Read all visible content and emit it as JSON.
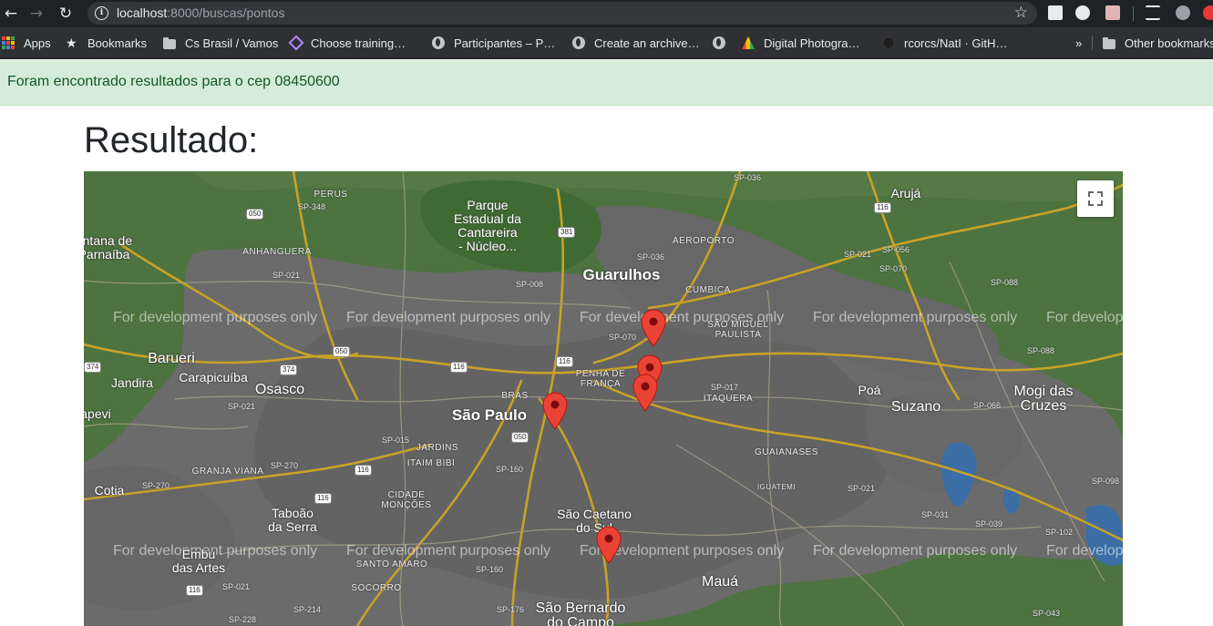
{
  "browser": {
    "url_host": "localhost",
    "url_path": ":8000/buscas/pontos",
    "back_icon": "arrow-left-icon",
    "forward_icon": "arrow-right-icon",
    "reload_icon": "reload-icon",
    "bookmarks": {
      "apps": "Apps",
      "bookmarks": "Bookmarks",
      "cs_brasil": "Cs Brasil / Vamos",
      "choose_training": "Choose training…",
      "participantes": "Participantes – P…",
      "create_archive": "Create an archive…",
      "digital_photo": "Digital Photogra…",
      "github": "rcorcs/NatI · GitH…",
      "overflow": "»",
      "other": "Other bookmarks"
    }
  },
  "alert": {
    "message": "Foram encontrado resultados para o cep 08450600",
    "color": "#d4edda"
  },
  "page": {
    "title": "Resultado:"
  },
  "map": {
    "watermark": "For development purposes only",
    "fullscreen_icon": "fullscreen-icon",
    "pin_color": "#ea4335",
    "labels": {
      "guarulhos": "Guarulhos",
      "sao_paulo": "São Paulo",
      "osasco": "Osasco",
      "barueri": "Barueri",
      "carapicuiba": "Carapicuíba",
      "jandira": "Jandira",
      "paulo_left": "apevi",
      "cotia": "Cotia",
      "taboao": "Taboão\nda Serra",
      "embu": "Embu\ndas Artes",
      "santana": "antana de\nParnaíba",
      "poa": "Poá",
      "suzano": "Suzano",
      "mogi": "Mogi das\nCruzes",
      "sao_caetano": "São Caetano\ndo Sul",
      "maua": "Mauá",
      "sao_bernardo": "São Bernardo\ndo Campo",
      "aruja": "Arujá",
      "park": "Parque\nEstadual da\nCantareira\n- Núcleo..."
    },
    "districts": {
      "perus": "PERUS",
      "anhanguera": "ANHANGUERA",
      "aeroporto": "AEROPORTO",
      "cumbica": "CUMBICA",
      "sao_miguel": "SÃO MIGUEL\nPAULISTA",
      "penha": "PENHA DE\nFRANÇA",
      "itaquera": "ITAQUERA",
      "bras": "BRÁS",
      "jardins": "JARDINS",
      "itaim": "ITAIM BIBI",
      "granja": "GRANJA VIANA",
      "cidade_moncoes": "CIDADE\nMONÇÕES",
      "guaianases": "GUAIANASES",
      "santo_amaro": "SANTO AMARO",
      "socorro": "SOCORRO",
      "iguatemi": "IGUATEMI"
    },
    "roads": {
      "sp036a": "SP-036",
      "sp348": "SP-348",
      "sp036b": "SP-036",
      "sp008": "SP-008",
      "sp021a": "SP-021",
      "sp070": "SP-070",
      "sp021b": "SP-021",
      "sp056": "SP-056",
      "sp070b": "SP-070",
      "sp088a": "SP-088",
      "sp088b": "SP-088",
      "sp017": "SP-017",
      "sp066": "SP-066",
      "sp021c": "SP-021",
      "sp015": "SP-015",
      "sp270a": "SP-270",
      "sp270b": "SP-270",
      "sp160a": "SP-160",
      "sp160b": "SP-160",
      "sp021d": "SP-021",
      "sp031": "SP-031",
      "sp039": "SP-039",
      "sp098": "SP-098",
      "sp102": "SP-102",
      "sp021e": "SP-021",
      "sp214": "SP-214",
      "sp176": "SP-176",
      "sp228": "SP-228",
      "sp043": "SP-043"
    },
    "shields": {
      "s050a": "050",
      "s116a": "116",
      "s381": "381",
      "s050b": "050",
      "s374a": "374",
      "s374b": "374",
      "s116b": "116",
      "s116c": "116",
      "s050c": "050",
      "s116d": "116",
      "s116e": "116",
      "s116f": "116"
    }
  }
}
